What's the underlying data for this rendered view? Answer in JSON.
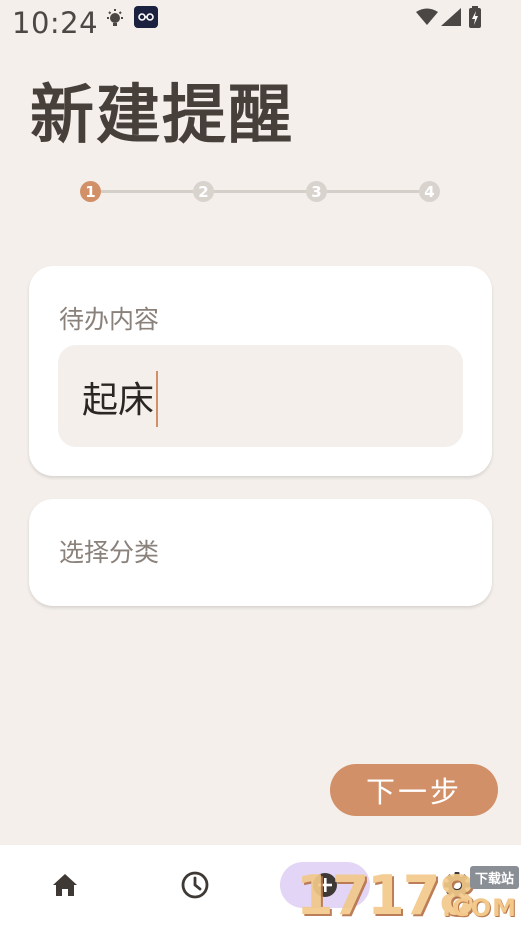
{
  "status_bar": {
    "time": "10:24"
  },
  "page": {
    "title": "新建提醒"
  },
  "stepper": {
    "steps": [
      "1",
      "2",
      "3",
      "4"
    ],
    "active_step": 1
  },
  "todo_card": {
    "label": "待办内容",
    "value": "起床"
  },
  "category_card": {
    "label": "选择分类"
  },
  "actions": {
    "next_label": "下一步"
  },
  "bottom_nav": {
    "items": [
      {
        "icon": "home-icon"
      },
      {
        "icon": "clock-icon"
      },
      {
        "icon": "add-icon",
        "selected": true
      },
      {
        "icon": "gear-icon"
      }
    ]
  },
  "watermark": {
    "number": "17178",
    "badge": "下载站",
    "domain": ".COM"
  },
  "colors": {
    "background": "#f4efeb",
    "accent": "#d29068",
    "title": "#463f3a",
    "nav_selected_pill": "#e2d5f5"
  }
}
